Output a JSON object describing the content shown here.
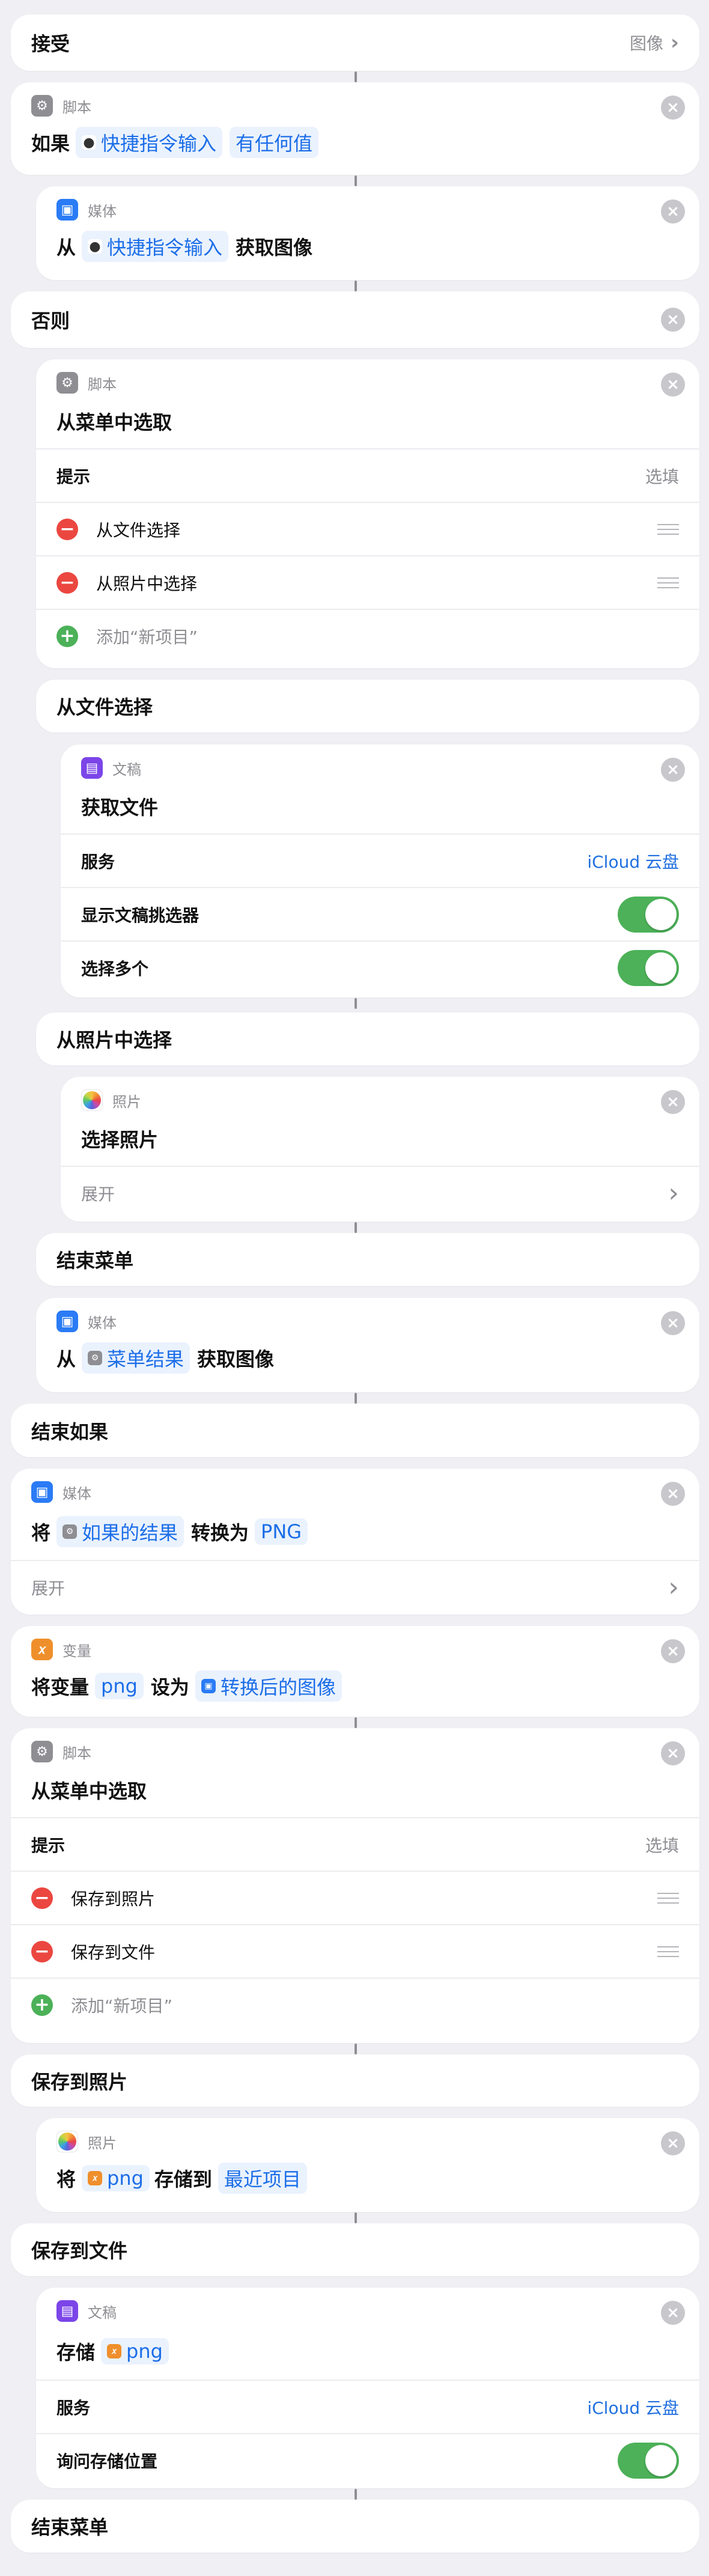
{
  "receive": {
    "label": "接受",
    "value": "图像"
  },
  "if_block": {
    "category": "脚本",
    "kw_if": "如果",
    "input": "快捷指令输入",
    "condition": "有任何值"
  },
  "get_image_1": {
    "category": "媒体",
    "kw_from": "从",
    "input": "快捷指令输入",
    "action": "获取图像"
  },
  "otherwise": {
    "label": "否则"
  },
  "menu_1": {
    "category": "脚本",
    "title": "从菜单中选取",
    "prompt_label": "提示",
    "prompt_placeholder": "选填",
    "items": [
      "从文件选择",
      "从照片中选择"
    ],
    "add_placeholder": "添加“新项目”"
  },
  "case_file": {
    "label": "从文件选择"
  },
  "get_file": {
    "category": "文稿",
    "title": "获取文件",
    "service_label": "服务",
    "service_value": "iCloud 云盘",
    "picker_label": "显示文稿挑选器",
    "multi_label": "选择多个"
  },
  "case_photo": {
    "label": "从照片中选择"
  },
  "select_photo": {
    "category": "照片",
    "title": "选择照片",
    "expand_label": "展开"
  },
  "end_menu_1": {
    "label": "结束菜单"
  },
  "get_image_2": {
    "category": "媒体",
    "kw_from": "从",
    "input": "菜单结果",
    "action": "获取图像"
  },
  "end_if": {
    "label": "结束如果"
  },
  "convert": {
    "category": "媒体",
    "kw_will": "将",
    "input": "如果的结果",
    "action": "转换为",
    "format": "PNG",
    "expand_label": "展开"
  },
  "set_var": {
    "category": "变量",
    "kw_set": "将变量",
    "var_name": "png",
    "kw_to": "设为",
    "value": "转换后的图像"
  },
  "menu_2": {
    "category": "脚本",
    "title": "从菜单中选取",
    "prompt_label": "提示",
    "prompt_placeholder": "选填",
    "items": [
      "保存到照片",
      "保存到文件"
    ],
    "add_placeholder": "添加“新项目”"
  },
  "case_save_photo": {
    "label": "保存到照片"
  },
  "save_photo": {
    "category": "照片",
    "kw_will": "将",
    "var": "png",
    "action": "存储到",
    "album": "最近项目"
  },
  "case_save_file": {
    "label": "保存到文件"
  },
  "save_file": {
    "category": "文稿",
    "kw_save": "存储",
    "var": "png",
    "service_label": "服务",
    "service_value": "iCloud 云盘",
    "ask_label": "询问存储位置"
  },
  "end_menu_2": {
    "label": "结束菜单"
  },
  "colors": {
    "accent": "#1c6ee8",
    "toggle_on": "#4cb158",
    "delete": "#eb4740",
    "background": "#efeff4"
  }
}
